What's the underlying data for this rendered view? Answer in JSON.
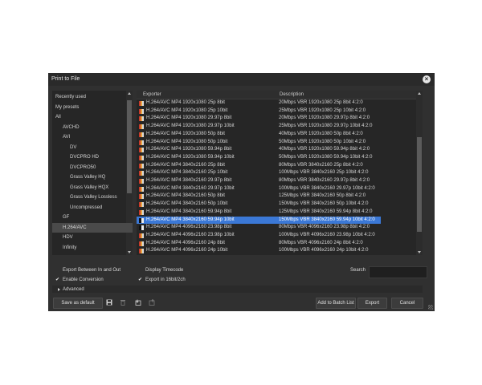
{
  "window": {
    "title": "Print to File"
  },
  "tree": [
    {
      "label": "Recently used",
      "indent": 0,
      "selected": false
    },
    {
      "label": "My presets",
      "indent": 0,
      "selected": false
    },
    {
      "label": "All",
      "indent": 0,
      "selected": false
    },
    {
      "label": "AVCHD",
      "indent": 1,
      "selected": false
    },
    {
      "label": "AVI",
      "indent": 1,
      "selected": false
    },
    {
      "label": "DV",
      "indent": 2,
      "selected": false
    },
    {
      "label": "DVCPRO HD",
      "indent": 2,
      "selected": false
    },
    {
      "label": "DVCPRO50",
      "indent": 2,
      "selected": false
    },
    {
      "label": "Grass Valley HQ",
      "indent": 2,
      "selected": false
    },
    {
      "label": "Grass Valley HQX",
      "indent": 2,
      "selected": false
    },
    {
      "label": "Grass Valley Lossless",
      "indent": 2,
      "selected": false
    },
    {
      "label": "Uncompressed",
      "indent": 2,
      "selected": false
    },
    {
      "label": "GF",
      "indent": 1,
      "selected": false
    },
    {
      "label": "H.264/AVC",
      "indent": 1,
      "selected": true
    },
    {
      "label": "HDV",
      "indent": 1,
      "selected": false
    },
    {
      "label": "Infinity",
      "indent": 1,
      "selected": false
    }
  ],
  "list": {
    "col_exporter": "Exporter",
    "col_description": "Description",
    "rows": [
      {
        "exporter": "H.264/AVC MP4 1920x1080 25p 8bit",
        "description": "20Mbps VBR 1920x1080 25p 8bit 4:2:0",
        "selected": false
      },
      {
        "exporter": "H.264/AVC MP4 1920x1080 25p 10bit",
        "description": "25Mbps VBR 1920x1080 25p 10bit 4:2:0",
        "selected": false
      },
      {
        "exporter": "H.264/AVC MP4 1920x1080 29.97p 8bit",
        "description": "20Mbps VBR 1920x1080 29.97p 8bit 4:2:0",
        "selected": false
      },
      {
        "exporter": "H.264/AVC MP4 1920x1080 29.97p 10bit",
        "description": "25Mbps VBR 1920x1080 29.97p 10bit 4:2:0",
        "selected": false
      },
      {
        "exporter": "H.264/AVC MP4 1920x1080 50p 8bit",
        "description": "40Mbps VBR 1920x1080 50p 8bit 4:2:0",
        "selected": false
      },
      {
        "exporter": "H.264/AVC MP4 1920x1080 50p 10bit",
        "description": "50Mbps VBR 1920x1080 50p 10bit 4:2:0",
        "selected": false
      },
      {
        "exporter": "H.264/AVC MP4 1920x1080 59.94p 8bit",
        "description": "40Mbps VBR 1920x1080 59.94p 8bit 4:2:0",
        "selected": false
      },
      {
        "exporter": "H.264/AVC MP4 1920x1080 59.94p 10bit",
        "description": "50Mbps VBR 1920x1080 59.94p 10bit 4:2:0",
        "selected": false
      },
      {
        "exporter": "H.264/AVC MP4 3840x2160 25p 8bit",
        "description": "80Mbps VBR 3840x2160 25p 8bit 4:2:0",
        "selected": false
      },
      {
        "exporter": "H.264/AVC MP4 3840x2160 25p 10bit",
        "description": "100Mbps VBR 3840x2160 25p 10bit 4:2:0",
        "selected": false
      },
      {
        "exporter": "H.264/AVC MP4 3840x2160 29.97p 8bit",
        "description": "80Mbps VBR 3840x2160 29.97p 8bit 4:2:0",
        "selected": false
      },
      {
        "exporter": "H.264/AVC MP4 3840x2160 29.97p 10bit",
        "description": "100Mbps VBR 3840x2160 29.97p 10bit 4:2:0",
        "selected": false
      },
      {
        "exporter": "H.264/AVC MP4 3840x2160 50p 8bit",
        "description": "125Mbps VBR 3840x2160 50p 8bit 4:2:0",
        "selected": false
      },
      {
        "exporter": "H.264/AVC MP4 3840x2160 50p 10bit",
        "description": "150Mbps VBR 3840x2160 50p 10bit 4:2:0",
        "selected": false
      },
      {
        "exporter": "H.264/AVC MP4 3840x2160 59.94p 8bit",
        "description": "125Mbps VBR 3840x2160 59.94p 8bit 4:2:0",
        "selected": false
      },
      {
        "exporter": "H.264/AVC MP4 3840x2160 59.94p 10bit",
        "description": "150Mbps VBR 3840x2160 59.94p 10bit 4:2:0",
        "selected": true
      },
      {
        "exporter": "H.264/AVC MP4 4096x2160 23.98p 8bit",
        "description": "80Mbps VBR 4096x2160 23.98p 8bit 4:2:0",
        "selected": false
      },
      {
        "exporter": "H.264/AVC MP4 4096x2160 23.98p 10bit",
        "description": "100Mbps VBR 4096x2160 23.98p 10bit 4:2:0",
        "selected": false
      },
      {
        "exporter": "H.264/AVC MP4 4096x2160 24p 8bit",
        "description": "80Mbps VBR 4096x2160 24p 8bit 4:2:0",
        "selected": false
      },
      {
        "exporter": "H.264/AVC MP4 4096x2160 24p 10bit",
        "description": "100Mbps VBR 4096x2160 24p 10bit 4:2:0",
        "selected": false
      }
    ]
  },
  "options": {
    "export_between_label": "Export Between In and Out",
    "export_between_checked": false,
    "enable_conversion_label": "Enable Conversion",
    "enable_conversion_checked": true,
    "display_timecode_label": "Display Timecode",
    "display_timecode_checked": false,
    "export_16bit_label": "Export in 16bit/2ch",
    "export_16bit_checked": true,
    "search_label": "Search",
    "search_value": "",
    "advanced_label": "Advanced"
  },
  "buttons": {
    "save_default": "Save as default",
    "add_batch": "Add to Batch List",
    "export": "Export",
    "cancel": "Cancel"
  },
  "icons": [
    "save-icon",
    "delete-icon",
    "import-preset-icon",
    "export-preset-icon",
    "close-icon"
  ],
  "colors": {
    "selection": "#3b78d6",
    "dialog_bg": "#303030"
  }
}
